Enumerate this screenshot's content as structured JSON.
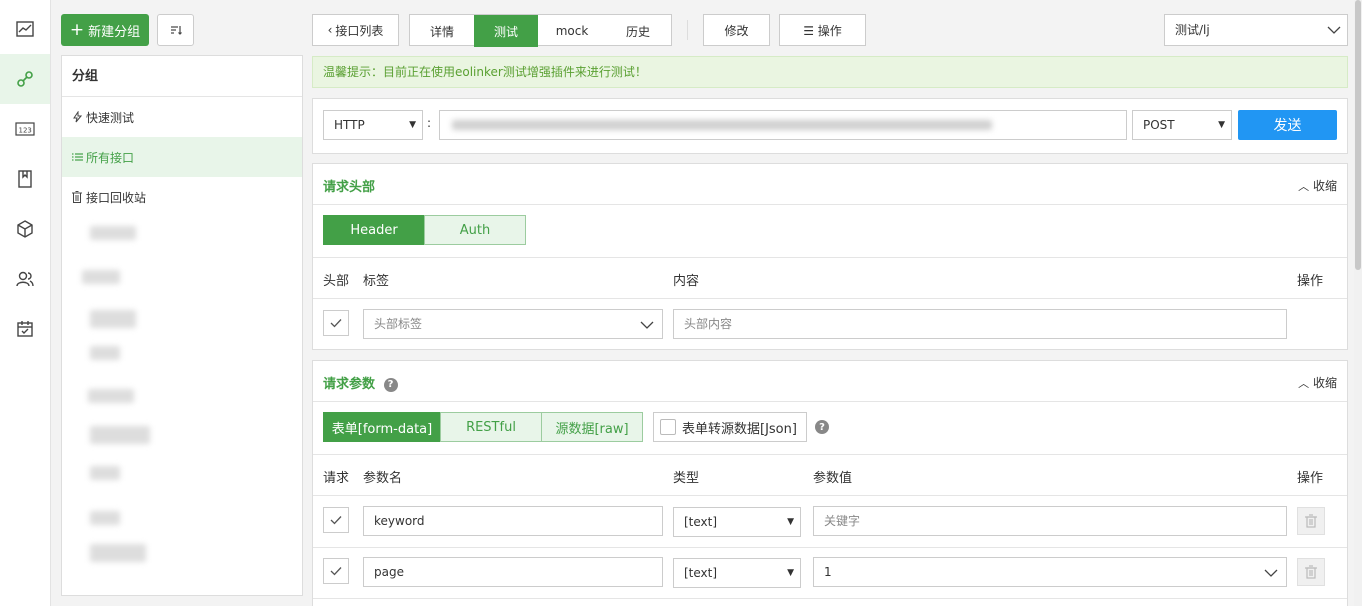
{
  "rail": {
    "icons": [
      "chart-icon",
      "link-icon",
      "number-icon",
      "document-icon",
      "cube-icon",
      "users-icon",
      "calendar-icon"
    ],
    "active_index": 1
  },
  "sidebar": {
    "new_group_label": "新建分组",
    "group_title": "分组",
    "items": [
      {
        "label": "快速测试",
        "icon": "bolt-icon"
      },
      {
        "label": "所有接口",
        "icon": "list-icon"
      },
      {
        "label": "接口回收站",
        "icon": "trash-icon"
      }
    ]
  },
  "toolbar": {
    "back_label": "接口列表",
    "tabs": [
      "详情",
      "测试",
      "mock",
      "历史"
    ],
    "active_tab": "测试",
    "edit_label": "修改",
    "actions_label": "☰ 操作",
    "project": "测试/lj"
  },
  "notice": "温馨提示：目前正在使用eolinker测试增强插件来进行测试！",
  "request": {
    "protocol": "HTTP",
    "method": "POST",
    "send_label": "发送"
  },
  "headers_section": {
    "title": "请求头部",
    "collapse_label": "收缩",
    "tabs": [
      "Header",
      "Auth"
    ],
    "columns": {
      "enable": "头部",
      "label": "标签",
      "content": "内容",
      "action": "操作"
    },
    "row": {
      "label_placeholder": "头部标签",
      "content_placeholder": "头部内容"
    }
  },
  "params_section": {
    "title": "请求参数",
    "collapse_label": "收缩",
    "tabs": [
      "表单[form-data]",
      "RESTful",
      "源数据[raw]"
    ],
    "json_toggle": "表单转源数据[Json]",
    "columns": {
      "enable": "请求",
      "name": "参数名",
      "type": "类型",
      "value": "参数值",
      "action": "操作"
    },
    "rows": [
      {
        "name": "keyword",
        "type": "[text]",
        "value": "关键字"
      },
      {
        "name": "page",
        "type": "[text]",
        "value": "1"
      }
    ]
  },
  "colors": {
    "accent": "#43a047",
    "send": "#2196f3",
    "notice": "#5aa032"
  }
}
